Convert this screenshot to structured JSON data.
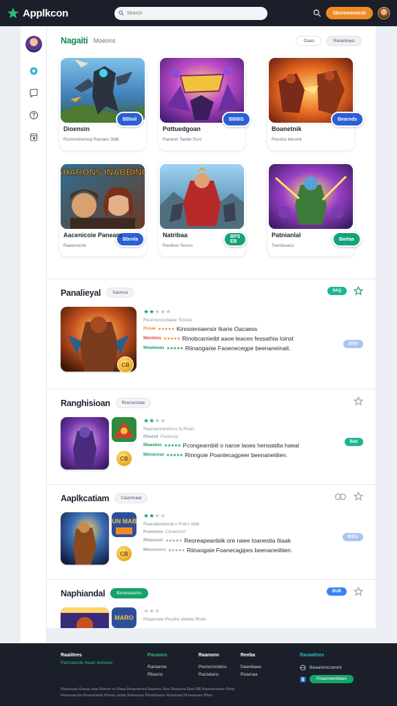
{
  "topbar": {
    "brand": "Applkcon",
    "search_placeholder": "Search",
    "cta_label": "Sbcreeremesh"
  },
  "rail": {
    "items": [
      {
        "icon": "gear-icon"
      },
      {
        "icon": "chat-icon"
      },
      {
        "icon": "help-icon"
      },
      {
        "icon": "bookmark-icon"
      }
    ]
  },
  "featured": {
    "title": "Nagaiti",
    "subtitle": "Moeons",
    "action_1": "Oaas",
    "action_2": "Reoehoea",
    "cards": [
      {
        "title": "Dioensin",
        "meta": "Rcmmstrersop  Ramais Sbllt",
        "badge": "BBloil"
      },
      {
        "title": "Pottuedgoan",
        "meta": "Paneon  Taebe Scrc",
        "badge": "BBBIS"
      },
      {
        "title": "Boanetnik",
        "meta": "Pocdoo beronk",
        "badge": "Bearnds"
      },
      {
        "title": "Aacenicoie Paneam",
        "meta": "Raeeinecte",
        "badge": "Bbrnla",
        "banner": "SHARONS INABBING"
      },
      {
        "title": "Natribaa",
        "meta": "Recibon Sonss",
        "badge": "BPS EB"
      },
      {
        "title": "Patnianlal",
        "meta": "Trembuacs",
        "badge": "Bartaa"
      }
    ]
  },
  "lists": [
    {
      "title": "Panalieyal",
      "pill": "Saonca",
      "tag": "IIAQ",
      "meta": "Reonnccrccbaee Tcooss",
      "coin": "CB",
      "action_tag": "Biild",
      "rows": [
        {
          "label": "Pusae",
          "text": "Kinnoieniaensir Ikarie  Oacaess"
        },
        {
          "label": "Mionbiss",
          "text": "Rinobcamieibt aaoe leaceo fessathia Ioinst"
        },
        {
          "label": "Moaeleaas",
          "text": "Riinaoganie Faoenecegpe beenaneinait."
        }
      ]
    },
    {
      "title": "Ranghisioan",
      "pill": "Rreconctee",
      "tag": "Bait",
      "meta": "Reorarmrerertrss Is Roon",
      "coin": "CB",
      "rows": [
        {
          "label": "Rlealstt",
          "text": "Pantesta"
        },
        {
          "label": "Mlaeatiec",
          "text": "Pcongearnbiil o naroe laoes hensatdta haeat"
        },
        {
          "label": "Mionsrose",
          "text": "Rinngoie Poantecagpeer beenaneiitien."
        }
      ]
    },
    {
      "title": "Aaplkcatiam",
      "pill": "Caonmaat",
      "tag": "BIDS",
      "meta": "Rearabestlooat n Prdrs sbtb",
      "coin": "CB",
      "banner": "BUN MABE",
      "rows": [
        {
          "label": "Pueeonso",
          "text": "Cleaeestrt"
        },
        {
          "label": "Mlaaoasie",
          "text": "Reoreapeanbiik ore raiee Ioanestia Itiaak"
        },
        {
          "label": "Mioonrsors",
          "text": "Riinaogaie Foanecagipes beenaneiitiien."
        }
      ]
    },
    {
      "title": "Naphiandal",
      "pill": "Boreceasms",
      "tag": "BUB",
      "meta": "Rbaancee Pocdra oteeba Rndo",
      "banner": "MARO"
    }
  ],
  "footer": {
    "brand": "Raaiitees",
    "tagline": "Pamuaeste Ikaan ieeloare",
    "cols": [
      {
        "title": "Pasaons",
        "links": [
          "Ranianne",
          "Rbaons"
        ]
      },
      {
        "title": "Raanonn",
        "links": [
          "Peoncrncbiins",
          "Ractatans"
        ]
      },
      {
        "title": "Reeba",
        "links": [
          "Deenbaee",
          "Roamaa"
        ]
      },
      {
        "title": "Ranaahms",
        "links": [
          "Beaannnccenmi"
        ]
      }
    ],
    "social_button": "Poaanneeobaes",
    "legal_1": "Raaenaas Raoas otas Rbesnl ro Raaa Reaenbrara Raaerta Sere Rearuha Ebai RB  Raneareeabe Rnas",
    "legal_2": "Reeanaecbe Reaoertaeb  Rhoaa cadas Raneeara Rbaebiaase  Reaaraad Rmeaeaee Rbes"
  },
  "colors": {
    "brand_green": "#16a36a",
    "accent_orange": "#f08a24",
    "badge_blue": "#2c5fd6",
    "dark_bar": "#1b1f29"
  }
}
